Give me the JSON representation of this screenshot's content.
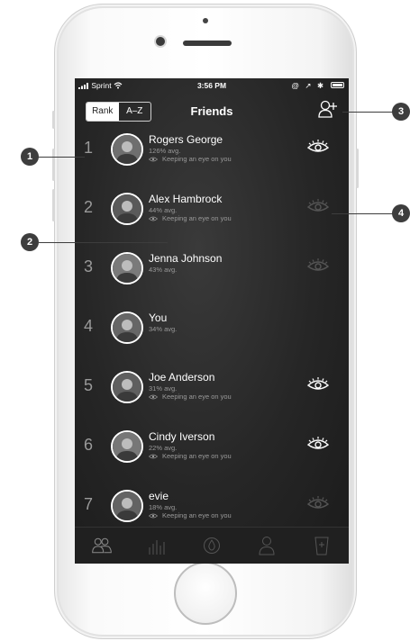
{
  "status_bar": {
    "carrier": "Sprint",
    "time": "3:56 PM",
    "right_icons": "@ ↗ ✱"
  },
  "header": {
    "segment": [
      {
        "label": "Rank",
        "active": true
      },
      {
        "label": "A–Z",
        "active": false
      }
    ],
    "title": "Friends",
    "add_icon": "add-friend-icon"
  },
  "friends": [
    {
      "rank": "1",
      "name": "Rogers George",
      "avg": "126% avg.",
      "status": "Keeping an eye on you",
      "watching": true
    },
    {
      "rank": "2",
      "name": "Alex Hambrock",
      "avg": "44% avg.",
      "status": "Keeping an eye on you",
      "watching": false
    },
    {
      "rank": "3",
      "name": "Jenna Johnson",
      "avg": "43% avg.",
      "status": "",
      "watching": false
    },
    {
      "rank": "4",
      "name": "You",
      "avg": "34% avg.",
      "status": "",
      "watching": null
    },
    {
      "rank": "5",
      "name": "Joe Anderson",
      "avg": "31% avg.",
      "status": "Keeping an eye on you",
      "watching": true
    },
    {
      "rank": "6",
      "name": "Cindy Iverson",
      "avg": "22% avg.",
      "status": "Keeping an eye on you",
      "watching": true
    },
    {
      "rank": "7",
      "name": "evie",
      "avg": "18% avg.",
      "status": "Keeping an eye on you",
      "watching": false
    }
  ],
  "tabbar": [
    {
      "icon": "friends-icon",
      "active": true
    },
    {
      "icon": "bars-icon",
      "active": false
    },
    {
      "icon": "drop-icon",
      "active": false
    },
    {
      "icon": "profile-icon",
      "active": false
    },
    {
      "icon": "add-glass-icon",
      "active": false
    }
  ],
  "callouts": [
    "1",
    "2",
    "3",
    "4"
  ],
  "colors": {
    "screen_bg": "#262626",
    "eye_active": "#ffffff",
    "eye_inactive": "#555555",
    "callout": "#3d3d3d"
  }
}
